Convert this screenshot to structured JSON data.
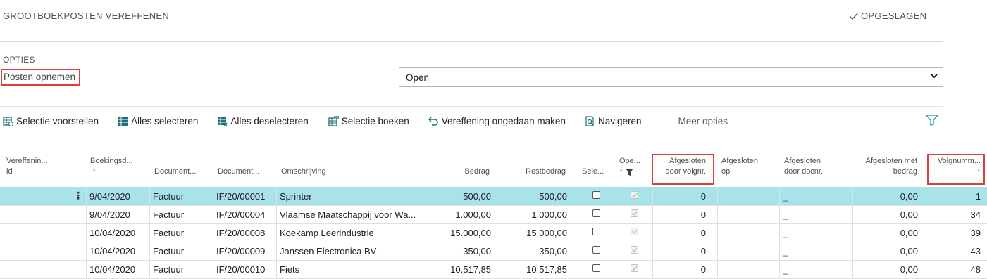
{
  "header": {
    "title": "GROOTBOEKPOSTEN VEREFFENEN",
    "saved_label": "OPGESLAGEN"
  },
  "options": {
    "section_title": "OPTIES",
    "field_label": "Posten opnemen",
    "field_value": "Open"
  },
  "toolbar": {
    "items": [
      {
        "label": "Selectie voorstellen",
        "icon": "suggest-icon"
      },
      {
        "label": "Alles selecteren",
        "icon": "select-all-icon"
      },
      {
        "label": "Alles deselecteren",
        "icon": "deselect-all-icon"
      },
      {
        "label": "Selectie boeken",
        "icon": "post-selection-icon"
      },
      {
        "label": "Vereffening ongedaan maken",
        "icon": "undo-icon"
      },
      {
        "label": "Navigeren",
        "icon": "navigate-icon"
      }
    ],
    "more_label": "Meer opties"
  },
  "table": {
    "headers": {
      "applies_id_1": "Vereffenin...",
      "applies_id_2": "id",
      "posting_date": "Boekingsd...",
      "posting_date_sort": "↑",
      "doc_type": "Document...",
      "doc_no": "Document...",
      "description": "Omschrijving",
      "amount": "Bedrag",
      "remaining": "Restbedrag",
      "selected": "Sele...",
      "open": "Ope...",
      "open_sort": "↑",
      "closed_by_seq_1": "Afgesloten",
      "closed_by_seq_2": "door volgnr.",
      "closed_at_1": "Afgesloten",
      "closed_at_2": "op",
      "closed_by_doc_1": "Afgesloten",
      "closed_by_doc_2": "door docnr.",
      "closed_amount_1": "Afgesloten met",
      "closed_amount_2": "bedrag",
      "seq_no": "Volgnumm...",
      "seq_sort": "↑"
    },
    "rows": [
      {
        "date": "9/04/2020",
        "doc_type": "Factuur",
        "doc_no": "IF/20/00001",
        "description": "Sprinter",
        "amount": "500,00",
        "remaining": "500,00",
        "closed_by_seq": "0",
        "closed_by_doc": "_",
        "closed_amount": "0,00",
        "seq": "1"
      },
      {
        "date": "9/04/2020",
        "doc_type": "Factuur",
        "doc_no": "IF/20/00004",
        "description": "Vlaamse Maatschappij voor Wa...",
        "amount": "1.000,00",
        "remaining": "1.000,00",
        "closed_by_seq": "0",
        "closed_by_doc": "_",
        "closed_amount": "0,00",
        "seq": "34"
      },
      {
        "date": "10/04/2020",
        "doc_type": "Factuur",
        "doc_no": "IF/20/00008",
        "description": "Koekamp Leerindustrie",
        "amount": "15.000,00",
        "remaining": "15.000,00",
        "closed_by_seq": "0",
        "closed_by_doc": "_",
        "closed_amount": "0,00",
        "seq": "39"
      },
      {
        "date": "10/04/2020",
        "doc_type": "Factuur",
        "doc_no": "IF/20/00009",
        "description": "Janssen Electronica BV",
        "amount": "350,00",
        "remaining": "350,00",
        "closed_by_seq": "0",
        "closed_by_doc": "_",
        "closed_amount": "0,00",
        "seq": "43"
      },
      {
        "date": "10/04/2020",
        "doc_type": "Factuur",
        "doc_no": "IF/20/00010",
        "description": "Fiets",
        "amount": "10.517,85",
        "remaining": "10.517,85",
        "closed_by_seq": "0",
        "closed_by_doc": "_",
        "closed_amount": "0,00",
        "seq": "48"
      }
    ]
  },
  "colors": {
    "accent_teal": "#1f9aa5",
    "selected_row": "#a9e3ea",
    "highlight_red": "#d9413d",
    "link": "#0f6ab4"
  }
}
